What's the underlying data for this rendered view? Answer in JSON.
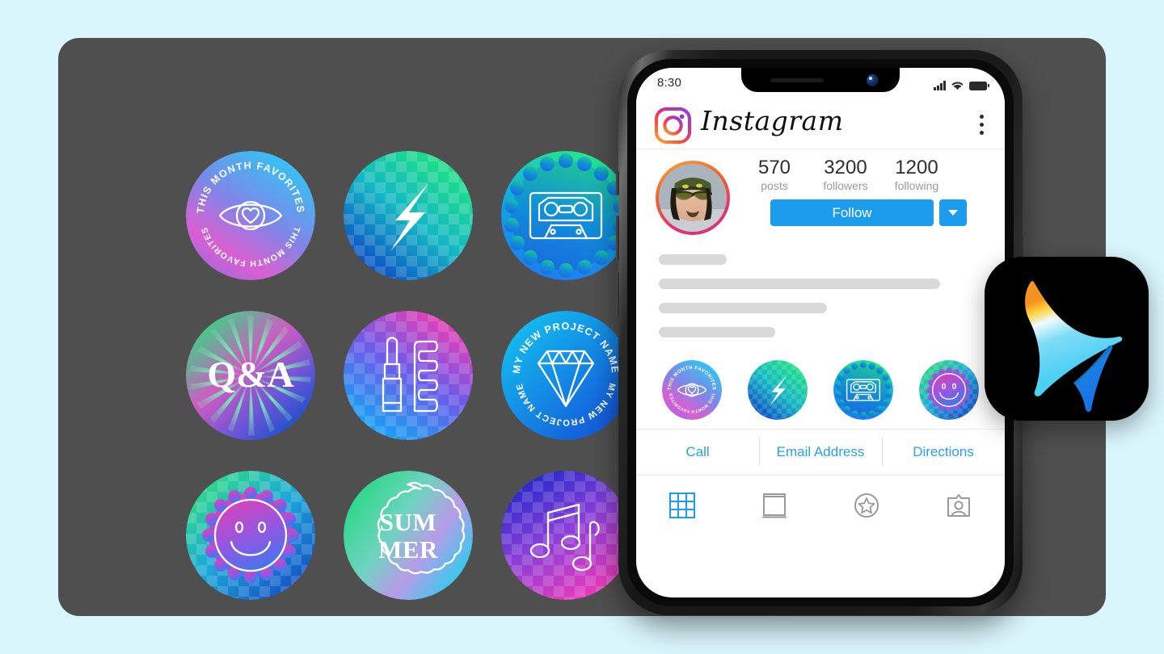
{
  "canvas": {
    "background_color": "#d9f6fc",
    "panel_color": "#4f4f4f"
  },
  "stickers": [
    {
      "id": "this-month-favorites",
      "icon": "eye-heart-icon",
      "text": "THIS MONTH FAVORITES",
      "style": "circular-text",
      "gradient": [
        "#2ec8f5",
        "#a06ae0",
        "#e45fd0"
      ]
    },
    {
      "id": "lightning-bolt",
      "icon": "lightning-bolt-icon",
      "text": "",
      "style": "checkerboard",
      "gradient": [
        "#1bd97a",
        "#0fb5e8",
        "#1044c8"
      ]
    },
    {
      "id": "cassette-tape",
      "icon": "cassette-tape-icon",
      "text": "",
      "style": "wavy-edge",
      "gradient": [
        "#23e88f",
        "#0f9be8",
        "#1f7ff0"
      ]
    },
    {
      "id": "q-and-a",
      "icon": "starburst-icon",
      "text": "Q&A",
      "style": "starburst",
      "gradient": [
        "#2fd88a",
        "#d45bc0",
        "#1b54c4"
      ]
    },
    {
      "id": "lipstick-comb",
      "icon": "lipstick-comb-icon",
      "text": "",
      "style": "checkerboard",
      "gradient": [
        "#e33fb8",
        "#6a5ce8",
        "#1ba0f5"
      ]
    },
    {
      "id": "my-new-project-name",
      "icon": "diamond-icon",
      "text": "MY NEW PROJECT NAME",
      "style": "circular-text",
      "gradient": [
        "#12b6ef",
        "#1352d8"
      ]
    },
    {
      "id": "smiley-face",
      "icon": "smiley-face-icon",
      "text": "",
      "style": "scalloped-badge",
      "gradient": [
        "#2fd88a",
        "#17a9e8",
        "#e248c8"
      ]
    },
    {
      "id": "summer",
      "icon": "wavy-frame-icon",
      "text": "SUM MER",
      "lines": [
        "SUM",
        "MER"
      ],
      "style": "wavy-frame",
      "gradient": [
        "#2fd88a",
        "#b49ae8",
        "#14d6ee"
      ]
    },
    {
      "id": "music-notes",
      "icon": "music-notes-icon",
      "text": "",
      "style": "checkerboard",
      "gradient": [
        "#2c2ad0",
        "#8a3fd8",
        "#f03ab8"
      ]
    }
  ],
  "phone": {
    "status_bar": {
      "time": "8:30",
      "signal_icon": "signal-bars-icon",
      "wifi_icon": "wifi-icon",
      "battery_icon": "battery-icon"
    },
    "app_header": {
      "logo_icon": "instagram-logo-icon",
      "title": "Instagram",
      "menu_icon": "kebab-menu-icon"
    },
    "profile": {
      "avatar_icon": "profile-avatar",
      "stats": [
        {
          "value": "570",
          "label": "posts"
        },
        {
          "value": "3200",
          "label": "followers"
        },
        {
          "value": "1200",
          "label": "following"
        }
      ],
      "follow_button": "Follow",
      "follow_more_icon": "chevron-down-icon",
      "accent_color": "#1c9ced",
      "bio_lines": [
        60,
        100,
        69,
        44
      ]
    },
    "highlights": [
      {
        "id": "hl-favorites",
        "icon": "eye-heart-icon",
        "text": "THIS MONTH FAVORITES"
      },
      {
        "id": "hl-bolt",
        "icon": "lightning-bolt-icon",
        "text": ""
      },
      {
        "id": "hl-cassette",
        "icon": "cassette-tape-icon",
        "text": ""
      },
      {
        "id": "hl-smiley",
        "icon": "smiley-face-icon",
        "text": ""
      }
    ],
    "action_links": [
      "Call",
      "Email Address",
      "Directions"
    ],
    "tabs": [
      {
        "id": "tab-grid",
        "icon": "grid-icon",
        "active": true
      },
      {
        "id": "tab-feed",
        "icon": "feed-icon",
        "active": false
      },
      {
        "id": "tab-star",
        "icon": "star-circle-icon",
        "active": false
      },
      {
        "id": "tab-tagged",
        "icon": "tagged-person-icon",
        "active": false
      }
    ]
  },
  "app_icon": {
    "name": "app-logo-icon",
    "background": "#000000",
    "colors": [
      "#f59320",
      "#ffe24d",
      "#9fe9fb",
      "#18b6f0",
      "#1766f0"
    ]
  }
}
